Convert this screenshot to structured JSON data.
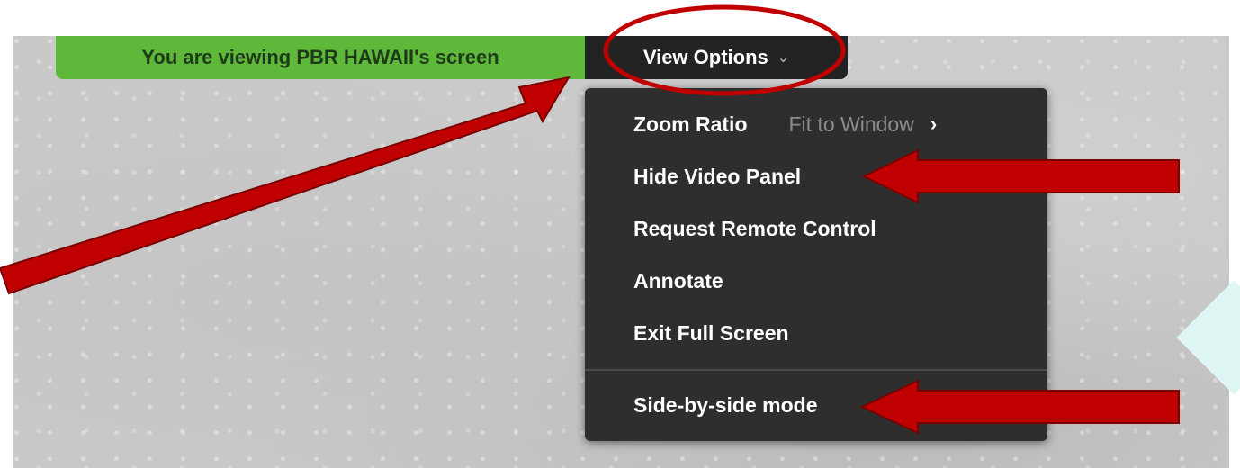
{
  "banner": {
    "text": "You are viewing PBR HAWAII's screen",
    "color": "#5fb83a"
  },
  "view_options": {
    "label": "View Options",
    "chevron": "⌄"
  },
  "menu": {
    "zoom_ratio": {
      "label": "Zoom Ratio",
      "value": "Fit to Window",
      "arrow": "›"
    },
    "hide_video_panel": "Hide Video Panel",
    "request_remote_control": "Request Remote Control",
    "annotate": "Annotate",
    "exit_full_screen": "Exit Full Screen",
    "side_by_side_mode": "Side-by-side mode"
  },
  "annotations": {
    "color": "#c00000",
    "arrow_icon": "arrow-icon",
    "highlight_icon": "ellipse-highlight"
  }
}
